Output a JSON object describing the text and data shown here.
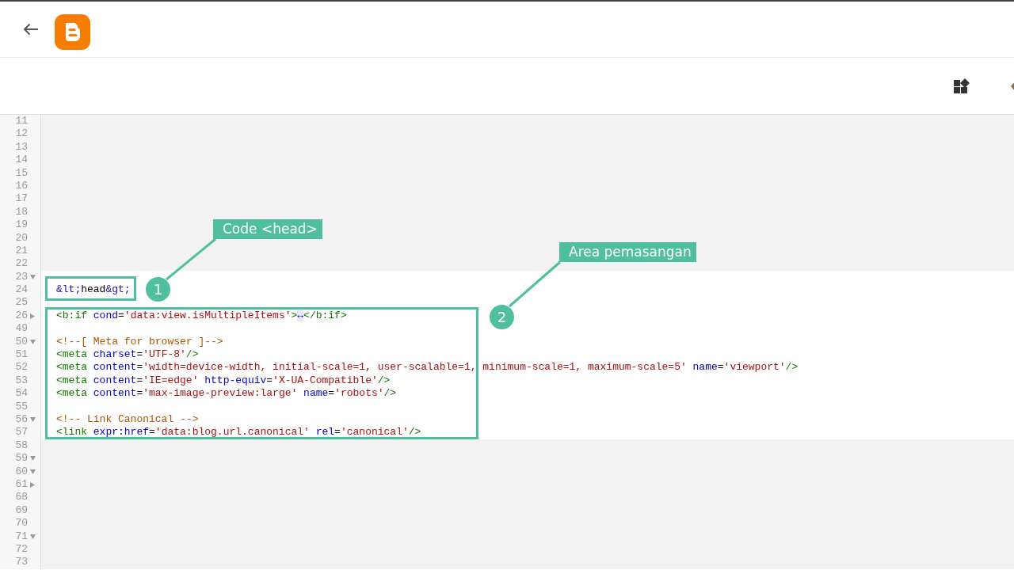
{
  "editor": {
    "lines": [
      {
        "number": "11",
        "dimmed": true
      },
      {
        "number": "12",
        "dimmed": true
      },
      {
        "number": "13",
        "dimmed": true
      },
      {
        "number": "14",
        "dimmed": true
      },
      {
        "number": "15",
        "dimmed": true
      },
      {
        "number": "16",
        "dimmed": true
      },
      {
        "number": "17",
        "dimmed": true
      },
      {
        "number": "18",
        "dimmed": true
      },
      {
        "number": "19",
        "dimmed": true
      },
      {
        "number": "20",
        "dimmed": true
      },
      {
        "number": "21",
        "dimmed": true
      },
      {
        "number": "22",
        "dimmed": true
      },
      {
        "number": "23",
        "dimmed": false,
        "expanded": true
      },
      {
        "number": "24",
        "dimmed": false,
        "tokens": [
          {
            "kind": "entity",
            "text": "&lt;"
          },
          {
            "kind": "text",
            "text": "head"
          },
          {
            "kind": "entity",
            "text": "&gt;"
          }
        ]
      },
      {
        "number": "25",
        "dimmed": false
      },
      {
        "number": "26",
        "dimmed": false,
        "expanded": false,
        "tokens": [
          {
            "kind": "tag",
            "text": "<b:if"
          },
          {
            "kind": "attr",
            "text": " cond"
          },
          {
            "kind": "text",
            "text": "="
          },
          {
            "kind": "string",
            "text": "'data:view.isMultipleItems'"
          },
          {
            "kind": "tag",
            "text": ">"
          },
          {
            "kind": "marker",
            "text": "↔"
          },
          {
            "kind": "tag",
            "text": "</b:if>"
          }
        ]
      },
      {
        "number": "49",
        "dimmed": false
      },
      {
        "number": "50",
        "dimmed": false,
        "expanded": true,
        "tokens": [
          {
            "kind": "comment",
            "text": "<!--[ Meta for browser ]-->"
          }
        ]
      },
      {
        "number": "51",
        "dimmed": false,
        "tokens": [
          {
            "kind": "tag",
            "text": "<meta"
          },
          {
            "kind": "attr",
            "text": " charset"
          },
          {
            "kind": "text",
            "text": "="
          },
          {
            "kind": "string",
            "text": "'UTF-8'"
          },
          {
            "kind": "tag",
            "text": "/>"
          }
        ]
      },
      {
        "number": "52",
        "dimmed": false,
        "tokens": [
          {
            "kind": "tag",
            "text": "<meta"
          },
          {
            "kind": "attr",
            "text": " content"
          },
          {
            "kind": "text",
            "text": "="
          },
          {
            "kind": "string",
            "text": "'width=device-width, initial-scale=1, user-scalable=1, minimum-scale=1, maximum-scale=5'"
          },
          {
            "kind": "attr",
            "text": " name"
          },
          {
            "kind": "text",
            "text": "="
          },
          {
            "kind": "string",
            "text": "'viewport'"
          },
          {
            "kind": "tag",
            "text": "/>"
          }
        ]
      },
      {
        "number": "53",
        "dimmed": false,
        "tokens": [
          {
            "kind": "tag",
            "text": "<meta"
          },
          {
            "kind": "attr",
            "text": " content"
          },
          {
            "kind": "text",
            "text": "="
          },
          {
            "kind": "string",
            "text": "'IE=edge'"
          },
          {
            "kind": "attr",
            "text": " http-equiv"
          },
          {
            "kind": "text",
            "text": "="
          },
          {
            "kind": "string",
            "text": "'X-UA-Compatible'"
          },
          {
            "kind": "tag",
            "text": "/>"
          }
        ]
      },
      {
        "number": "54",
        "dimmed": false,
        "tokens": [
          {
            "kind": "tag",
            "text": "<meta"
          },
          {
            "kind": "attr",
            "text": " content"
          },
          {
            "kind": "text",
            "text": "="
          },
          {
            "kind": "string",
            "text": "'max-image-preview:large'"
          },
          {
            "kind": "attr",
            "text": " name"
          },
          {
            "kind": "text",
            "text": "="
          },
          {
            "kind": "string",
            "text": "'robots'"
          },
          {
            "kind": "tag",
            "text": "/>"
          }
        ]
      },
      {
        "number": "55",
        "dimmed": false
      },
      {
        "number": "56",
        "dimmed": false,
        "expanded": true,
        "tokens": [
          {
            "kind": "comment",
            "text": "<!-- Link Canonical -->"
          }
        ]
      },
      {
        "number": "57",
        "dimmed": false,
        "tokens": [
          {
            "kind": "tag",
            "text": "<link"
          },
          {
            "kind": "attr",
            "text": " expr:href"
          },
          {
            "kind": "text",
            "text": "="
          },
          {
            "kind": "string",
            "text": "'data:blog.url.canonical'"
          },
          {
            "kind": "attr",
            "text": " rel"
          },
          {
            "kind": "text",
            "text": "="
          },
          {
            "kind": "string",
            "text": "'canonical'"
          },
          {
            "kind": "tag",
            "text": "/>"
          }
        ]
      },
      {
        "number": "58",
        "dimmed": true
      },
      {
        "number": "59",
        "dimmed": true,
        "expanded": true
      },
      {
        "number": "60",
        "dimmed": true,
        "expanded": true
      },
      {
        "number": "61",
        "dimmed": true,
        "expanded": false
      },
      {
        "number": "68",
        "dimmed": true
      },
      {
        "number": "69",
        "dimmed": true
      },
      {
        "number": "70",
        "dimmed": true
      },
      {
        "number": "71",
        "dimmed": true,
        "expanded": true
      },
      {
        "number": "72",
        "dimmed": true
      },
      {
        "number": "73",
        "dimmed": true
      }
    ]
  },
  "callouts": [
    {
      "label": "Code <head>",
      "badge": "1"
    },
    {
      "label": "Area pemasangan",
      "badge": "2"
    }
  ]
}
